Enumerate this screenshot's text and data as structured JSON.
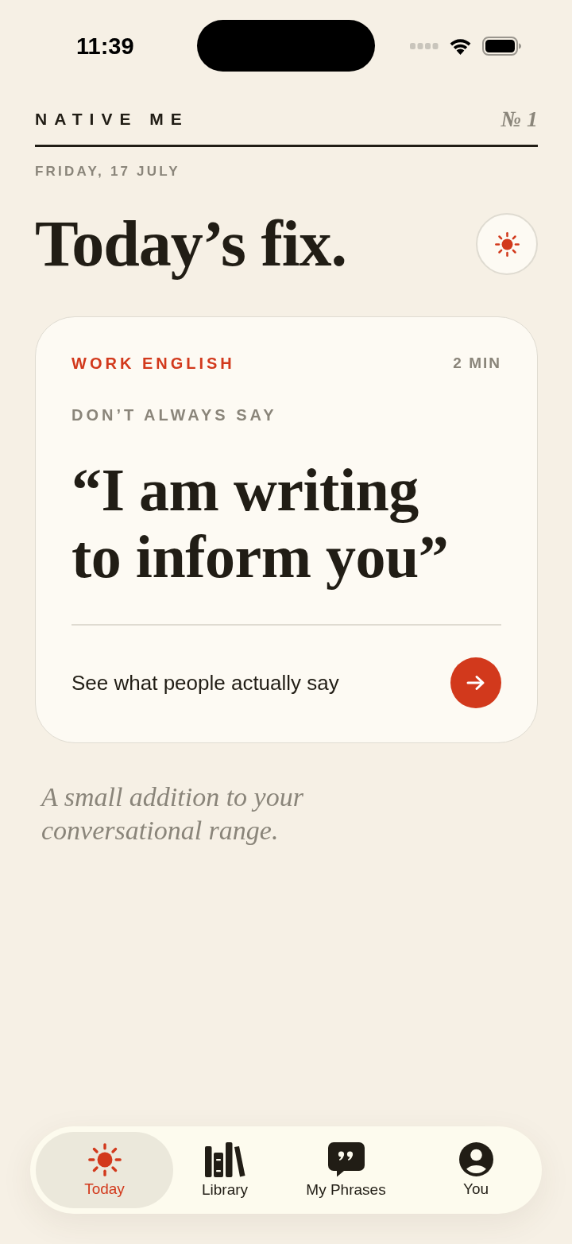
{
  "status_bar": {
    "time": "11:39"
  },
  "masthead": {
    "title": "NATIVE ME",
    "issue": "№ 1"
  },
  "date": "FRIDAY, 17 JULY",
  "heading": "Today’s fix.",
  "card": {
    "category": "WORK ENGLISH",
    "duration": "2 MIN",
    "eyebrow": "DON’T ALWAYS SAY",
    "phrase": "“I am writing to inform you”",
    "prompt": "See what people actually say"
  },
  "tagline": "A small addition to your conversational range.",
  "tab_bar": {
    "tabs": [
      {
        "label": "Today",
        "selected": true
      },
      {
        "label": "Library",
        "selected": false
      },
      {
        "label": "My Phrases",
        "selected": false
      },
      {
        "label": "You",
        "selected": false
      }
    ]
  }
}
